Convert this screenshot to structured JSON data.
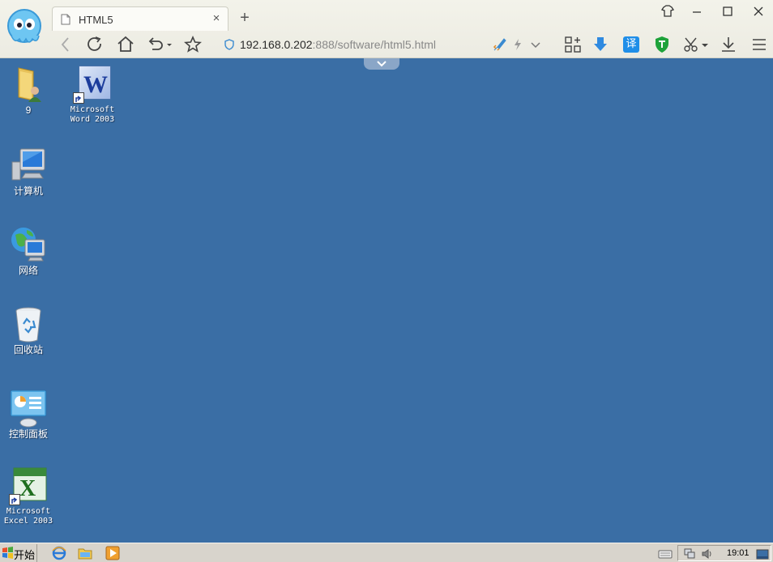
{
  "browser": {
    "tab_title": "HTML5",
    "tab_close": "×",
    "new_tab": "+",
    "url_host": "192.168.0.202",
    "url_rest": ":888/software/html5.html",
    "translate_label": "译"
  },
  "desktop": {
    "background": "#3a6ea5",
    "icons": [
      {
        "label": "9",
        "icon": "user-folder-icon"
      },
      {
        "label": "Microsoft\nWord 2003",
        "icon": "word-icon"
      },
      {
        "label": "计算机",
        "icon": "computer-icon"
      },
      {
        "label": "网络",
        "icon": "network-icon"
      },
      {
        "label": "回收站",
        "icon": "recycle-bin-icon"
      },
      {
        "label": "控制面板",
        "icon": "control-panel-icon"
      },
      {
        "label": "Microsoft\nExcel 2003",
        "icon": "excel-icon"
      }
    ]
  },
  "taskbar": {
    "start_label": "开始",
    "clock": "19:01"
  }
}
